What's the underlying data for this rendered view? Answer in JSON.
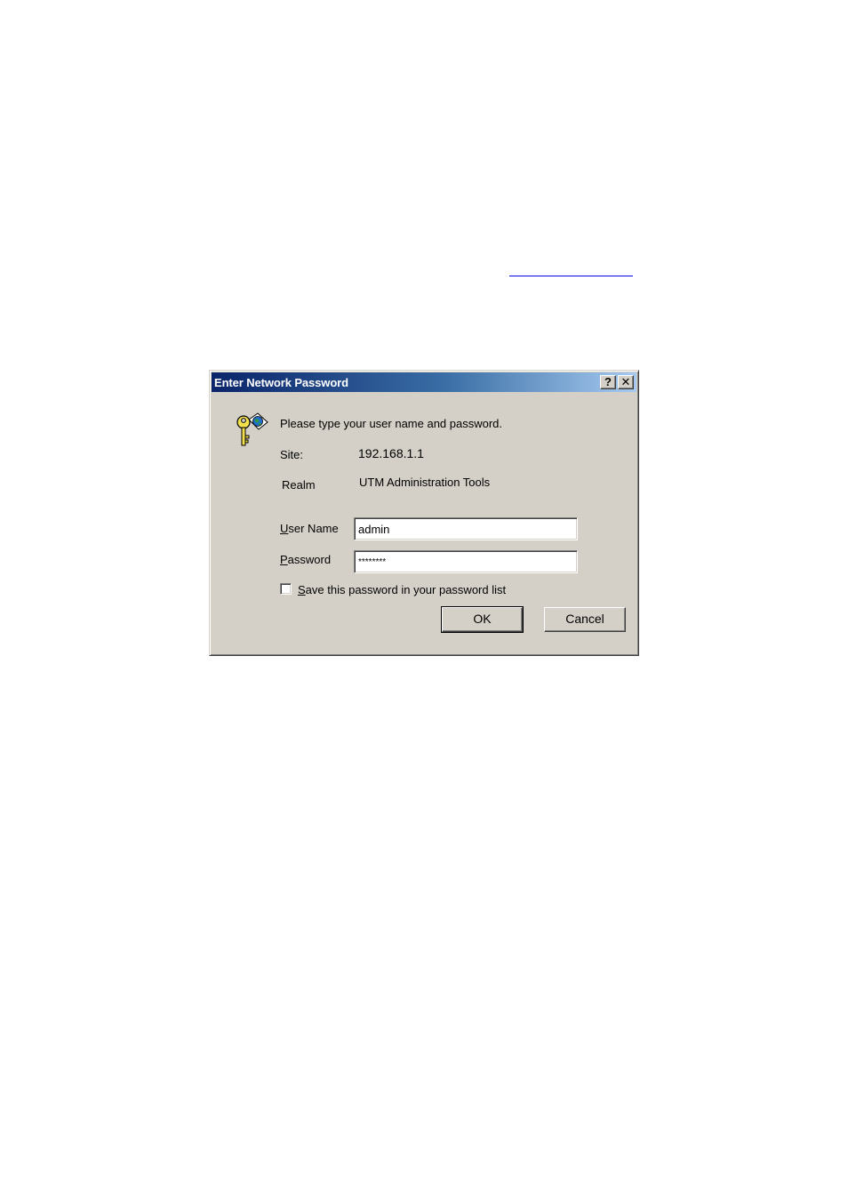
{
  "dialog": {
    "title": "Enter Network Password",
    "help_button": "?",
    "close_button": "✕",
    "prompt": "Please type your user name and password.",
    "site_label": "Site:",
    "site_value": "192.168.1.1",
    "realm_label": "Realm",
    "realm_value": "UTM Administration Tools",
    "user_name_label_accel": "U",
    "user_name_label_rest": "ser Name",
    "user_name_value": "admin",
    "password_label_accel": "P",
    "password_label_rest": "assword",
    "password_value": "********",
    "save_password_accel": "S",
    "save_password_rest": "ave this password in your password list",
    "save_password_checked": false,
    "ok_label": "OK",
    "cancel_label": "Cancel"
  },
  "colors": {
    "dialog_face": "#d4d0c8",
    "title_gradient_start": "#0a246a",
    "title_gradient_end": "#a6caf0",
    "link_underline": "#0000ee"
  },
  "icons": {
    "dialog_icon": "key-globe-icon"
  }
}
